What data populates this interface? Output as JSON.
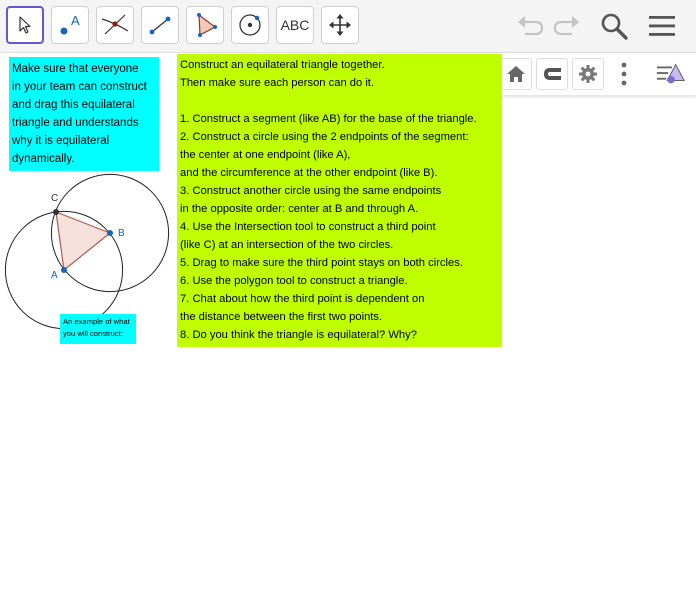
{
  "toolbar": {
    "tools": [
      {
        "name": "Move",
        "icon": "arrow-cursor-icon",
        "selected": true
      },
      {
        "name": "Point",
        "icon": "point-icon",
        "letter": "A"
      },
      {
        "name": "Intersect",
        "icon": "intersect-icon"
      },
      {
        "name": "Segment",
        "icon": "segment-icon"
      },
      {
        "name": "Polygon",
        "icon": "polygon-icon"
      },
      {
        "name": "Circle with Center through Point",
        "icon": "circle-center-point-icon"
      },
      {
        "name": "Text",
        "label": "ABC"
      },
      {
        "name": "Move Graphics View",
        "icon": "move-graphics-view-icon"
      }
    ],
    "right": [
      "undo-icon",
      "redo-icon",
      "search-icon",
      "menu-icon"
    ]
  },
  "stylebar": [
    "axes-icon",
    "grid-icon",
    "home-icon",
    "magnet-icon",
    "gear-icon",
    "more-vert-icon",
    "view-toggle-icon"
  ],
  "colors": {
    "cyan": "#00ffff",
    "lime": "#bfff00",
    "accent": "#6557d2",
    "point_blue": "#1565c0",
    "triangle_fill": "#f4dcd7",
    "triangle_edge": "#b05a4a"
  },
  "note": {
    "lines": [
      "Make sure that everyone",
      "in your team can construct",
      "and drag this equilateral",
      "triangle and understands",
      "why it is equilateral",
      "dynamically."
    ]
  },
  "instructions": {
    "lines": [
      "Construct an equilateral triangle together.",
      "Then make sure each person can do it.",
      "",
      "1. Construct a segment (like AB) for the base of the triangle.",
      "2. Construct a circle using the 2 endpoints of the segment:",
      "the center at one endpoint (like A),",
      "and the circumference at the other endpoint (like B).",
      "3. Construct another circle using the same endpoints",
      "in the opposite order: center at B and through A.",
      "4. Use the Intersection tool to construct a third point",
      "(like C) at an intersection of the two circles.",
      "5. Drag to make sure the third point stays on both circles.",
      "6. Use the polygon tool to construct a triangle.",
      "7. Chat about how the third point is dependent on",
      "the distance between the first two points.",
      "8. Do you think the triangle is equilateral? Why?"
    ]
  },
  "example": {
    "lines": [
      "An example of what",
      "you will construct:"
    ],
    "points": {
      "A": "A",
      "B": "B",
      "C": "C"
    }
  }
}
